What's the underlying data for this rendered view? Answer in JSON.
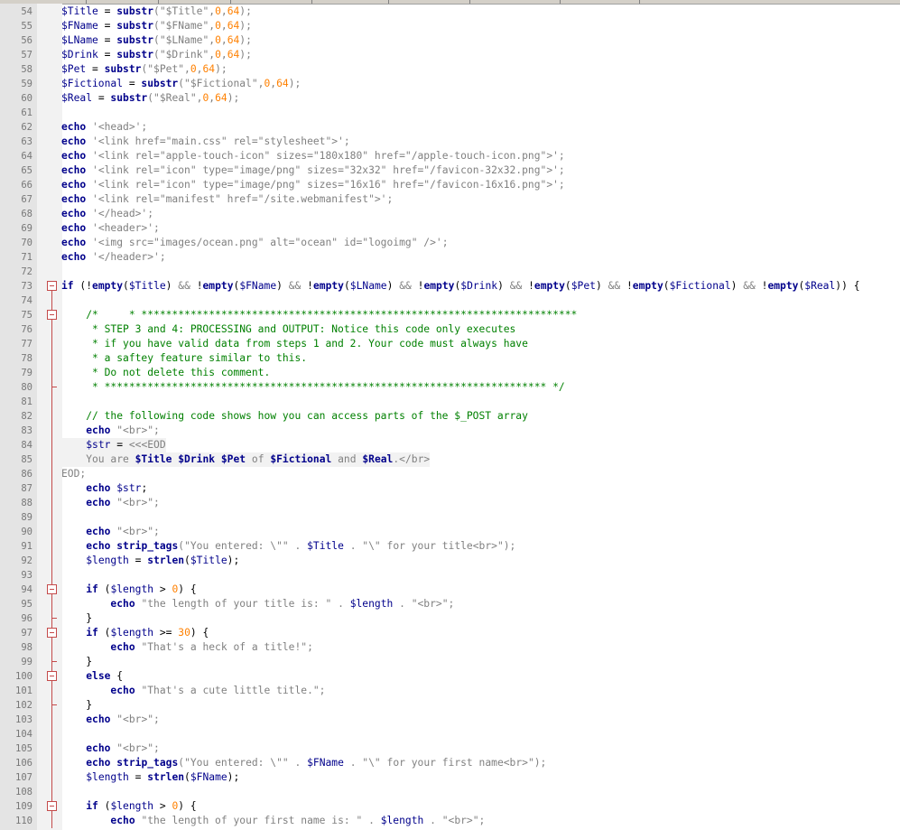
{
  "colors": {
    "keyword": "#00008b",
    "variable": "#00008b",
    "string": "#808080",
    "number": "#ff8000",
    "comment": "#008000",
    "operator": "#808080",
    "fold_marker": "#c44a4a",
    "gutter": "#e4e4e4"
  },
  "lines": [
    {
      "n": "54",
      "t": [
        [
          "var",
          "$Title"
        ],
        [
          "plain",
          " = "
        ],
        [
          "kw",
          "substr"
        ],
        [
          "str",
          "(\"$Title\""
        ],
        [
          "op",
          ","
        ],
        [
          "num",
          "0"
        ],
        [
          "op",
          ","
        ],
        [
          "num",
          "64"
        ],
        [
          "str",
          ");"
        ]
      ]
    },
    {
      "n": "55",
      "t": [
        [
          "var",
          "$FName"
        ],
        [
          "plain",
          " = "
        ],
        [
          "kw",
          "substr"
        ],
        [
          "str",
          "(\"$FName\""
        ],
        [
          "op",
          ","
        ],
        [
          "num",
          "0"
        ],
        [
          "op",
          ","
        ],
        [
          "num",
          "64"
        ],
        [
          "str",
          ");"
        ]
      ]
    },
    {
      "n": "56",
      "t": [
        [
          "var",
          "$LName"
        ],
        [
          "plain",
          " = "
        ],
        [
          "kw",
          "substr"
        ],
        [
          "str",
          "(\"$LName\""
        ],
        [
          "op",
          ","
        ],
        [
          "num",
          "0"
        ],
        [
          "op",
          ","
        ],
        [
          "num",
          "64"
        ],
        [
          "str",
          ");"
        ]
      ]
    },
    {
      "n": "57",
      "t": [
        [
          "var",
          "$Drink"
        ],
        [
          "plain",
          " = "
        ],
        [
          "kw",
          "substr"
        ],
        [
          "str",
          "(\"$Drink\""
        ],
        [
          "op",
          ","
        ],
        [
          "num",
          "0"
        ],
        [
          "op",
          ","
        ],
        [
          "num",
          "64"
        ],
        [
          "str",
          ");"
        ]
      ]
    },
    {
      "n": "58",
      "t": [
        [
          "var",
          "$Pet"
        ],
        [
          "plain",
          " = "
        ],
        [
          "kw",
          "substr"
        ],
        [
          "str",
          "(\"$Pet\""
        ],
        [
          "op",
          ","
        ],
        [
          "num",
          "0"
        ],
        [
          "op",
          ","
        ],
        [
          "num",
          "64"
        ],
        [
          "str",
          ");"
        ]
      ]
    },
    {
      "n": "59",
      "t": [
        [
          "var",
          "$Fictional"
        ],
        [
          "plain",
          " = "
        ],
        [
          "kw",
          "substr"
        ],
        [
          "str",
          "(\"$Fictional\""
        ],
        [
          "op",
          ","
        ],
        [
          "num",
          "0"
        ],
        [
          "op",
          ","
        ],
        [
          "num",
          "64"
        ],
        [
          "str",
          ");"
        ]
      ]
    },
    {
      "n": "60",
      "t": [
        [
          "var",
          "$Real"
        ],
        [
          "plain",
          " = "
        ],
        [
          "kw",
          "substr"
        ],
        [
          "str",
          "(\"$Real\""
        ],
        [
          "op",
          ","
        ],
        [
          "num",
          "0"
        ],
        [
          "op",
          ","
        ],
        [
          "num",
          "64"
        ],
        [
          "str",
          ");"
        ]
      ]
    },
    {
      "n": "61",
      "t": []
    },
    {
      "n": "62",
      "t": [
        [
          "kw",
          "echo"
        ],
        [
          "str",
          " '<head>';"
        ]
      ]
    },
    {
      "n": "63",
      "t": [
        [
          "kw",
          "echo"
        ],
        [
          "str",
          " '<link href=\"main.css\" rel=\"stylesheet\">';"
        ]
      ]
    },
    {
      "n": "64",
      "t": [
        [
          "kw",
          "echo"
        ],
        [
          "str",
          " '<link rel=\"apple-touch-icon\" sizes=\"180x180\" href=\"/apple-touch-icon.png\">';"
        ]
      ]
    },
    {
      "n": "65",
      "t": [
        [
          "kw",
          "echo"
        ],
        [
          "str",
          " '<link rel=\"icon\" type=\"image/png\" sizes=\"32x32\" href=\"/favicon-32x32.png\">';"
        ]
      ]
    },
    {
      "n": "66",
      "t": [
        [
          "kw",
          "echo"
        ],
        [
          "str",
          " '<link rel=\"icon\" type=\"image/png\" sizes=\"16x16\" href=\"/favicon-16x16.png\">';"
        ]
      ]
    },
    {
      "n": "67",
      "t": [
        [
          "kw",
          "echo"
        ],
        [
          "str",
          " '<link rel=\"manifest\" href=\"/site.webmanifest\">';"
        ]
      ]
    },
    {
      "n": "68",
      "t": [
        [
          "kw",
          "echo"
        ],
        [
          "str",
          " '</head>';"
        ]
      ]
    },
    {
      "n": "69",
      "t": [
        [
          "kw",
          "echo"
        ],
        [
          "str",
          " '<header>';"
        ]
      ]
    },
    {
      "n": "70",
      "t": [
        [
          "kw",
          "echo"
        ],
        [
          "str",
          " '<img src=\"images/ocean.png\" alt=\"ocean\" id=\"logoimg\" />';"
        ]
      ]
    },
    {
      "n": "71",
      "t": [
        [
          "kw",
          "echo"
        ],
        [
          "str",
          " '</header>';"
        ]
      ]
    },
    {
      "n": "72",
      "t": []
    },
    {
      "n": "73",
      "t": [
        [
          "kw",
          "if"
        ],
        [
          "plain",
          " ("
        ],
        [
          "plain",
          "!"
        ],
        [
          "kw",
          "empty"
        ],
        [
          "plain",
          "("
        ],
        [
          "var",
          "$Title"
        ],
        [
          "plain",
          ") "
        ],
        [
          "op",
          "&&"
        ],
        [
          "plain",
          " !"
        ],
        [
          "kw",
          "empty"
        ],
        [
          "plain",
          "("
        ],
        [
          "var",
          "$FName"
        ],
        [
          "plain",
          ") "
        ],
        [
          "op",
          "&&"
        ],
        [
          "plain",
          " !"
        ],
        [
          "kw",
          "empty"
        ],
        [
          "plain",
          "("
        ],
        [
          "var",
          "$LName"
        ],
        [
          "plain",
          ") "
        ],
        [
          "op",
          "&&"
        ],
        [
          "plain",
          " !"
        ],
        [
          "kw",
          "empty"
        ],
        [
          "plain",
          "("
        ],
        [
          "var",
          "$Drink"
        ],
        [
          "plain",
          ") "
        ],
        [
          "op",
          "&&"
        ],
        [
          "plain",
          " !"
        ],
        [
          "kw",
          "empty"
        ],
        [
          "plain",
          "("
        ],
        [
          "var",
          "$Pet"
        ],
        [
          "plain",
          ") "
        ],
        [
          "op",
          "&&"
        ],
        [
          "plain",
          " !"
        ],
        [
          "kw",
          "empty"
        ],
        [
          "plain",
          "("
        ],
        [
          "var",
          "$Fictional"
        ],
        [
          "plain",
          ") "
        ],
        [
          "op",
          "&&"
        ],
        [
          "plain",
          " !"
        ],
        [
          "kw",
          "empty"
        ],
        [
          "plain",
          "("
        ],
        [
          "var",
          "$Real"
        ],
        [
          "plain",
          ")) {"
        ]
      ]
    },
    {
      "n": "74",
      "t": []
    },
    {
      "n": "75",
      "t": [
        [
          "com",
          "    /*     * ***********************************************************************"
        ]
      ]
    },
    {
      "n": "76",
      "t": [
        [
          "com",
          "     * STEP 3 and 4: PROCESSING and OUTPUT: Notice this code only executes"
        ]
      ]
    },
    {
      "n": "77",
      "t": [
        [
          "com",
          "     * if you have valid data from steps 1 and 2. Your code must always have"
        ]
      ]
    },
    {
      "n": "78",
      "t": [
        [
          "com",
          "     * a saftey feature similar to this."
        ]
      ]
    },
    {
      "n": "79",
      "t": [
        [
          "com",
          "     * Do not delete this comment."
        ]
      ]
    },
    {
      "n": "80",
      "t": [
        [
          "com",
          "     * ************************************************************************ */"
        ]
      ]
    },
    {
      "n": "81",
      "t": []
    },
    {
      "n": "82",
      "t": [
        [
          "com",
          "    // the following code shows how you can access parts of the $_POST array"
        ]
      ]
    },
    {
      "n": "83",
      "t": [
        [
          "plain",
          "    "
        ],
        [
          "kw",
          "echo"
        ],
        [
          "str",
          " \"<br>\";"
        ]
      ]
    },
    {
      "n": "84",
      "t": [
        [
          "plain",
          "    "
        ],
        [
          "var",
          "$str"
        ],
        [
          "plain",
          " = "
        ],
        [
          "hd",
          "<<<EOD"
        ]
      ]
    },
    {
      "n": "85",
      "t": [
        [
          "hd",
          "    You are "
        ],
        [
          "kw",
          "$Title"
        ],
        [
          "hd",
          " "
        ],
        [
          "kw",
          "$Drink"
        ],
        [
          "hd",
          " "
        ],
        [
          "kw",
          "$Pet"
        ],
        [
          "hd",
          " of "
        ],
        [
          "kw",
          "$Fictional"
        ],
        [
          "hd",
          " and "
        ],
        [
          "kw",
          "$Real"
        ],
        [
          "hd",
          ".</br>"
        ]
      ]
    },
    {
      "n": "86",
      "t": [
        [
          "hd",
          "EOD;"
        ]
      ]
    },
    {
      "n": "87",
      "t": [
        [
          "plain",
          "    "
        ],
        [
          "kw",
          "echo"
        ],
        [
          "plain",
          " "
        ],
        [
          "var",
          "$str"
        ],
        [
          "plain",
          ";"
        ]
      ]
    },
    {
      "n": "88",
      "t": [
        [
          "plain",
          "    "
        ],
        [
          "kw",
          "echo"
        ],
        [
          "str",
          " \"<br>\";"
        ]
      ]
    },
    {
      "n": "89",
      "t": []
    },
    {
      "n": "90",
      "t": [
        [
          "plain",
          "    "
        ],
        [
          "kw",
          "echo"
        ],
        [
          "str",
          " \"<br>\";"
        ]
      ]
    },
    {
      "n": "91",
      "t": [
        [
          "plain",
          "    "
        ],
        [
          "kw",
          "echo"
        ],
        [
          "plain",
          " "
        ],
        [
          "kw",
          "strip_tags"
        ],
        [
          "str",
          "(\"You entered: \\\"\" . "
        ],
        [
          "var",
          "$Title"
        ],
        [
          "str",
          " . \"\\\" for your title<br>\");"
        ]
      ]
    },
    {
      "n": "92",
      "t": [
        [
          "plain",
          "    "
        ],
        [
          "var",
          "$length"
        ],
        [
          "plain",
          " = "
        ],
        [
          "kw",
          "strlen"
        ],
        [
          "plain",
          "("
        ],
        [
          "var",
          "$Title"
        ],
        [
          "plain",
          ");"
        ]
      ]
    },
    {
      "n": "93",
      "t": []
    },
    {
      "n": "94",
      "t": [
        [
          "plain",
          "    "
        ],
        [
          "kw",
          "if"
        ],
        [
          "plain",
          " ("
        ],
        [
          "var",
          "$length"
        ],
        [
          "plain",
          " > "
        ],
        [
          "num",
          "0"
        ],
        [
          "plain",
          ") {"
        ]
      ]
    },
    {
      "n": "95",
      "t": [
        [
          "plain",
          "        "
        ],
        [
          "kw",
          "echo"
        ],
        [
          "str",
          " \"the length of your title is: \" . "
        ],
        [
          "var",
          "$length"
        ],
        [
          "str",
          " . \"<br>\";"
        ]
      ]
    },
    {
      "n": "96",
      "t": [
        [
          "plain",
          "    }"
        ]
      ]
    },
    {
      "n": "97",
      "t": [
        [
          "plain",
          "    "
        ],
        [
          "kw",
          "if"
        ],
        [
          "plain",
          " ("
        ],
        [
          "var",
          "$length"
        ],
        [
          "plain",
          " >= "
        ],
        [
          "num",
          "30"
        ],
        [
          "plain",
          ") {"
        ]
      ]
    },
    {
      "n": "98",
      "t": [
        [
          "plain",
          "        "
        ],
        [
          "kw",
          "echo"
        ],
        [
          "str",
          " \"That's a heck of a title!\";"
        ]
      ]
    },
    {
      "n": "99",
      "t": [
        [
          "plain",
          "    }"
        ]
      ]
    },
    {
      "n": "100",
      "t": [
        [
          "plain",
          "    "
        ],
        [
          "kw",
          "else"
        ],
        [
          "plain",
          " {"
        ]
      ]
    },
    {
      "n": "101",
      "t": [
        [
          "plain",
          "        "
        ],
        [
          "kw",
          "echo"
        ],
        [
          "str",
          " \"That's a cute little title.\";"
        ]
      ]
    },
    {
      "n": "102",
      "t": [
        [
          "plain",
          "    }"
        ]
      ]
    },
    {
      "n": "103",
      "t": [
        [
          "plain",
          "    "
        ],
        [
          "kw",
          "echo"
        ],
        [
          "str",
          " \"<br>\";"
        ]
      ]
    },
    {
      "n": "104",
      "t": []
    },
    {
      "n": "105",
      "t": [
        [
          "plain",
          "    "
        ],
        [
          "kw",
          "echo"
        ],
        [
          "str",
          " \"<br>\";"
        ]
      ]
    },
    {
      "n": "106",
      "t": [
        [
          "plain",
          "    "
        ],
        [
          "kw",
          "echo"
        ],
        [
          "plain",
          " "
        ],
        [
          "kw",
          "strip_tags"
        ],
        [
          "str",
          "(\"You entered: \\\"\" . "
        ],
        [
          "var",
          "$FName"
        ],
        [
          "str",
          " . \"\\\" for your first name<br>\");"
        ]
      ]
    },
    {
      "n": "107",
      "t": [
        [
          "plain",
          "    "
        ],
        [
          "var",
          "$length"
        ],
        [
          "plain",
          " = "
        ],
        [
          "kw",
          "strlen"
        ],
        [
          "plain",
          "("
        ],
        [
          "var",
          "$FName"
        ],
        [
          "plain",
          ");"
        ]
      ]
    },
    {
      "n": "108",
      "t": []
    },
    {
      "n": "109",
      "t": [
        [
          "plain",
          "    "
        ],
        [
          "kw",
          "if"
        ],
        [
          "plain",
          " ("
        ],
        [
          "var",
          "$length"
        ],
        [
          "plain",
          " > "
        ],
        [
          "num",
          "0"
        ],
        [
          "plain",
          ") {"
        ]
      ]
    },
    {
      "n": "110",
      "t": [
        [
          "plain",
          "        "
        ],
        [
          "kw",
          "echo"
        ],
        [
          "str",
          " \"the length of your first name is: \" . "
        ],
        [
          "var",
          "$length"
        ],
        [
          "str",
          " . \"<br>\";"
        ]
      ]
    }
  ]
}
